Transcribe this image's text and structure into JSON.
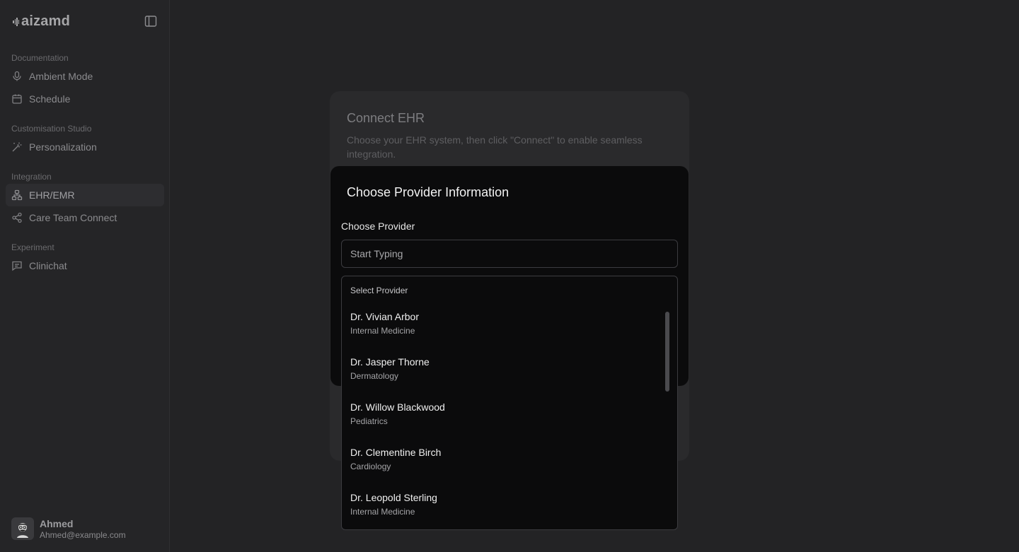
{
  "brand": {
    "name": "aizamd"
  },
  "sidebar": {
    "sections": [
      {
        "label": "Documentation"
      },
      {
        "label": "Customisation Studio"
      },
      {
        "label": "Integration"
      },
      {
        "label": "Experiment"
      }
    ],
    "items": [
      {
        "label": "Ambient Mode",
        "icon": "microphone-icon"
      },
      {
        "label": "Schedule",
        "icon": "calendar-icon"
      },
      {
        "label": "Personalization",
        "icon": "magic-wand-icon"
      },
      {
        "label": "EHR/EMR",
        "icon": "network-icon",
        "active": true
      },
      {
        "label": "Care Team Connect",
        "icon": "share-icon"
      },
      {
        "label": "Clinichat",
        "icon": "chat-icon"
      }
    ]
  },
  "user": {
    "name": "Ahmed",
    "email": "Ahmed@example.com"
  },
  "card": {
    "title": "Connect EHR",
    "description": "Choose your EHR system, then click \"Connect\" to enable seamless integration."
  },
  "modal": {
    "title": "Choose Provider Information",
    "field_label": "Choose Provider",
    "input_placeholder": "Start Typing",
    "input_value": ""
  },
  "dropdown": {
    "heading": "Select Provider",
    "providers": [
      {
        "name": "Dr. Vivian Arbor",
        "specialty": "Internal Medicine"
      },
      {
        "name": "Dr. Jasper Thorne",
        "specialty": "Dermatology"
      },
      {
        "name": "Dr. Willow Blackwood",
        "specialty": "Pediatrics"
      },
      {
        "name": "Dr. Clementine Birch",
        "specialty": "Cardiology"
      },
      {
        "name": "Dr. Leopold Sterling",
        "specialty": "Internal Medicine"
      }
    ]
  },
  "colors": {
    "background": "#232325",
    "sidebar": "#252527",
    "modal": "#0b0b0c",
    "border": "#3c3c40"
  }
}
